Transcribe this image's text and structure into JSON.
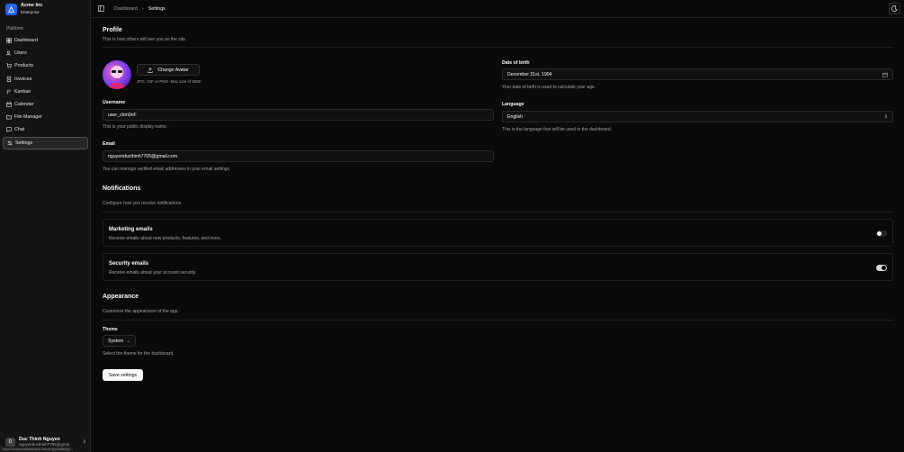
{
  "brand": {
    "name": "Acme Inc",
    "plan": "Enterprise"
  },
  "sidebar": {
    "group_label": "Platform",
    "items": [
      {
        "label": "Dashboard",
        "icon": "dashboard-icon"
      },
      {
        "label": "Users",
        "icon": "users-icon"
      },
      {
        "label": "Products",
        "icon": "cart-icon"
      },
      {
        "label": "Invoices",
        "icon": "invoice-icon"
      },
      {
        "label": "Kanban",
        "icon": "kanban-icon"
      },
      {
        "label": "Calendar",
        "icon": "calendar-icon"
      },
      {
        "label": "File Manager",
        "icon": "folder-icon"
      },
      {
        "label": "Chat",
        "icon": "chat-icon"
      },
      {
        "label": "Settings",
        "icon": "settings-icon",
        "active": true
      }
    ],
    "user": {
      "initial": "D",
      "name": "Duc Thinh Nguyen",
      "email": "nguyenducthinh7705@gmai"
    }
  },
  "status_url": "https://adminodashboard.vercel.app/settings",
  "breadcrumb": {
    "parent": "Dashboard",
    "current": "Settings"
  },
  "profile": {
    "title": "Profile",
    "desc": "This is how others will see you on the site.",
    "change_avatar": "Change Avatar",
    "avatar_hint": "JPG, GIF or PNG. Max size of 800K",
    "username_label": "Username",
    "username_value": "user_cbm0nF",
    "username_help": "This is your public display name.",
    "email_label": "Email",
    "email_value": "nguyenducthinh7705@gmail.com",
    "email_help": "You can manage verified email addresses in your email settings.",
    "dob_label": "Date of birth",
    "dob_value": "December 31st, 1994",
    "dob_help": "Your date of birth is used to calculate your age.",
    "language_label": "Language",
    "language_value": "English",
    "language_help": "This is the language that will be used in the dashboard."
  },
  "notifications": {
    "title": "Notifications",
    "desc": "Configure how you receive notifications.",
    "marketing_title": "Marketing emails",
    "marketing_desc": "Receive emails about new products, features, and more.",
    "marketing_enabled": false,
    "security_title": "Security emails",
    "security_desc": "Receive emails about your account security.",
    "security_enabled": true
  },
  "appearance": {
    "title": "Appearance",
    "desc": "Customize the appearance of the app.",
    "theme_label": "Theme",
    "theme_value": "System",
    "theme_help": "Select the theme for the dashboard."
  },
  "save_label": "Save settings"
}
